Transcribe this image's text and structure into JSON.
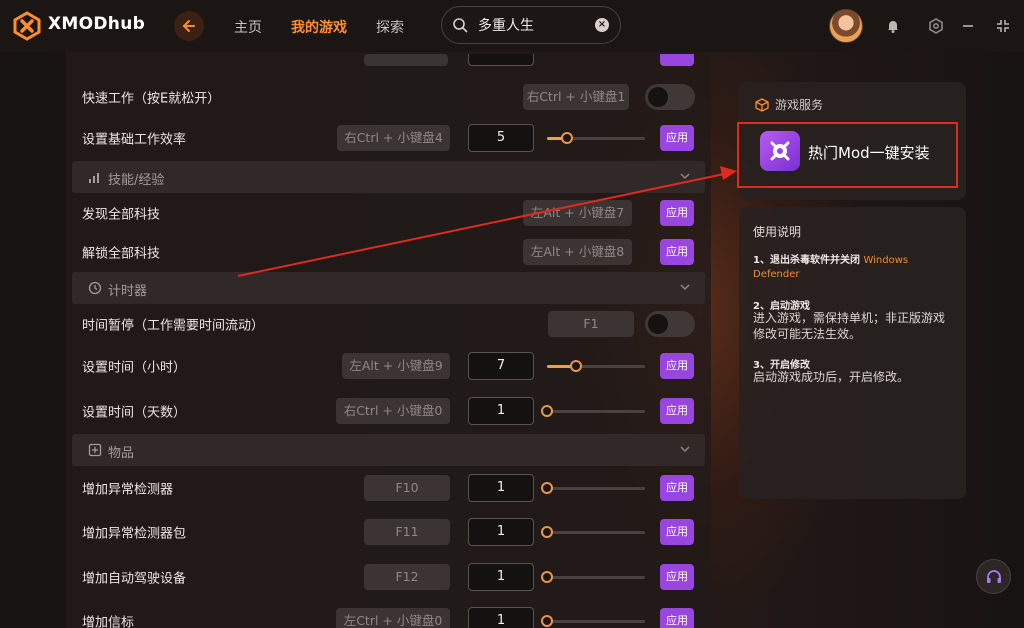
{
  "app": {
    "brand": "XMODhub"
  },
  "nav": {
    "home": "主页",
    "my_games": "我的游戏",
    "explore": "探索"
  },
  "search": {
    "value": "多重人生",
    "clear_icon": "clear-icon"
  },
  "colors": {
    "accent": "#ff8d2c",
    "apply": "#9945e0",
    "slider": "#f0a33a",
    "highlight_box": "#e12a1f"
  },
  "rows": {
    "quick_work": {
      "label": "快速工作（按E就松开）",
      "hotkey": "右Ctrl + 小键盘1",
      "toggle_on": false
    },
    "base_efficiency": {
      "label": "设置基础工作效率",
      "hotkey": "右Ctrl + 小键盘4",
      "value": "5",
      "slider_fraction": 0.2,
      "apply": "应用"
    },
    "discover_tech": {
      "label": "发现全部科技",
      "hotkey": "左Alt + 小键盘7",
      "apply": "应用"
    },
    "unlock_tech": {
      "label": "解锁全部科技",
      "hotkey": "左Alt + 小键盘8",
      "apply": "应用"
    },
    "time_pause": {
      "label": "时间暂停（工作需要时间流动）",
      "hotkey": "F1",
      "toggle_on": false
    },
    "set_hours": {
      "label": "设置时间（小时）",
      "hotkey": "左Alt + 小键盘9",
      "value": "7",
      "slider_fraction": 0.3,
      "apply": "应用"
    },
    "set_days": {
      "label": "设置时间（天数）",
      "hotkey": "右Ctrl + 小键盘0",
      "value": "1",
      "slider_fraction": 0.0,
      "apply": "应用"
    },
    "add_detector": {
      "label": "增加异常检测器",
      "hotkey": "F10",
      "value": "1",
      "slider_fraction": 0.0,
      "apply": "应用"
    },
    "add_detector_pack": {
      "label": "增加异常检测器包",
      "hotkey": "F11",
      "value": "1",
      "slider_fraction": 0.0,
      "apply": "应用"
    },
    "add_autopilot": {
      "label": "增加自动驾驶设备",
      "hotkey": "F12",
      "value": "1",
      "slider_fraction": 0.0,
      "apply": "应用"
    },
    "add_beacon": {
      "label": "增加信标",
      "hotkey": "左Ctrl + 小键盘0",
      "value": "1",
      "slider_fraction": 0.0,
      "apply": "应用"
    }
  },
  "sections": {
    "skills": "技能/经验",
    "timer": "计时器",
    "items": "物品"
  },
  "services": {
    "title": "游戏服务",
    "mod_install": "热门Mod一键安装"
  },
  "instructions": {
    "title": "使用说明",
    "step1_title": "1、退出杀毒软件并关闭",
    "step1_warn": "Windows Defender",
    "step2_title": "2、启动游戏",
    "step2_body": "进入游戏，需保持单机；非正版游戏修改可能无法生效。",
    "step3_title": "3、开启修改",
    "step3_body": "启动游戏成功后，开启修改。"
  }
}
